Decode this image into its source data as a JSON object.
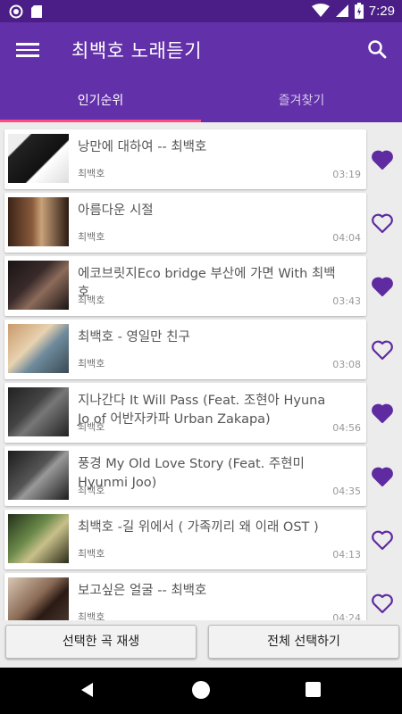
{
  "status_bar": {
    "time": "7:29"
  },
  "app_bar": {
    "title": "최백호 노래듣기"
  },
  "tabs": [
    {
      "label": "인기순위",
      "selected": true
    },
    {
      "label": "즐겨찾기",
      "selected": false
    }
  ],
  "colors": {
    "primary": "#6230a8",
    "status_bar": "#4b1d86",
    "accent": "#ff4a84",
    "heart": "#5e2ba0"
  },
  "songs": [
    {
      "title": "낭만에 대하여 -- 최백호",
      "artist": "최백호",
      "duration": "03:19",
      "favorite": true
    },
    {
      "title": "아름다운 시절",
      "artist": "최백호",
      "duration": "04:04",
      "favorite": false
    },
    {
      "title": "에코브릿지Eco bridge 부산에 가면 With 최백호",
      "artist": "최백호",
      "duration": "03:43",
      "favorite": true
    },
    {
      "title": "최백호 - 영일만 친구",
      "artist": "최백호",
      "duration": "03:08",
      "favorite": false
    },
    {
      "title": "지나간다 It Will Pass (Feat. 조현아 Hyuna Jo of 어반자카파 Urban Zakapa)",
      "artist": "최백호",
      "duration": "04:56",
      "favorite": true
    },
    {
      "title": "풍경 My Old Love Story (Feat. 주현미 Hyunmi Joo)",
      "artist": "최백호",
      "duration": "04:35",
      "favorite": true
    },
    {
      "title": "최백호 -길 위에서 ( 가족끼리 왜 이래 OST )",
      "artist": "최백호",
      "duration": "04:13",
      "favorite": false
    },
    {
      "title": "보고싶은 얼굴 -- 최백호",
      "artist": "최백호",
      "duration": "04:24",
      "favorite": false
    }
  ],
  "actions": {
    "play_selected": "선택한 곡 재생",
    "select_all": "전체 선택하기"
  }
}
